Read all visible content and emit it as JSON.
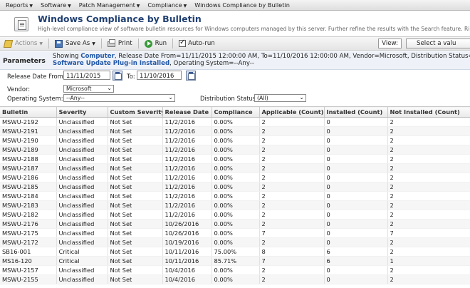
{
  "menu": [
    {
      "label": "Reports",
      "caret": true
    },
    {
      "label": "Software",
      "caret": true
    },
    {
      "label": "Patch Management",
      "caret": true
    },
    {
      "label": "Compliance",
      "caret": true
    },
    {
      "label": "Windows Compliance by Bulletin",
      "caret": false
    }
  ],
  "header": {
    "title": "Windows Compliance by Bulletin",
    "subtitle": "High-level compliance view of software bulletin resources for Windows computers managed by this server. Further refine the results with the Search feature. Ri"
  },
  "toolbar": {
    "actions_label": "Actions",
    "save_as_label": "Save As",
    "print_label": "Print",
    "run_label": "Run",
    "autorun_label": "Auto-run",
    "autorun_checked": true,
    "view_label": "View:",
    "view_select_value": "Select a valu"
  },
  "parameters": {
    "label": "Parameters",
    "line1_prefix": "Showing ",
    "line1_highlight": "Computer",
    "line1_rest": ", Release Date From=11/11/2015 12:00:00 AM, To=11/10/2016 12:00:00 AM, Vendor=Microsoft, Distribution Status=(",
    "line2_highlight": "Software Update Plug-in Installed",
    "line2_rest": ", Operating System=--Any--"
  },
  "filters": {
    "release_from_label": "Release Date From:",
    "release_from_value": "11/11/2015",
    "to_label": "To:",
    "to_value": "11/10/2016",
    "vendor_label": "Vendor:",
    "vendor_value": "Microsoft",
    "os_label": "Operating System:",
    "os_value": "--Any--",
    "dist_label": "Distribution Status:",
    "dist_value": "(All)"
  },
  "table": {
    "columns": [
      "Bulletin",
      "Severity",
      "Custom Severity",
      "Release Date",
      "Compliance",
      "Applicable (Count)",
      "Installed (Count)",
      "Not Installed (Count)"
    ],
    "rows": [
      [
        "MSWU-2192",
        "Unclassified",
        "Not Set",
        "11/2/2016",
        "0.00%",
        "2",
        "0",
        "2"
      ],
      [
        "MSWU-2191",
        "Unclassified",
        "Not Set",
        "11/2/2016",
        "0.00%",
        "2",
        "0",
        "2"
      ],
      [
        "MSWU-2190",
        "Unclassified",
        "Not Set",
        "11/2/2016",
        "0.00%",
        "2",
        "0",
        "2"
      ],
      [
        "MSWU-2189",
        "Unclassified",
        "Not Set",
        "11/2/2016",
        "0.00%",
        "2",
        "0",
        "2"
      ],
      [
        "MSWU-2188",
        "Unclassified",
        "Not Set",
        "11/2/2016",
        "0.00%",
        "2",
        "0",
        "2"
      ],
      [
        "MSWU-2187",
        "Unclassified",
        "Not Set",
        "11/2/2016",
        "0.00%",
        "2",
        "0",
        "2"
      ],
      [
        "MSWU-2186",
        "Unclassified",
        "Not Set",
        "11/2/2016",
        "0.00%",
        "2",
        "0",
        "2"
      ],
      [
        "MSWU-2185",
        "Unclassified",
        "Not Set",
        "11/2/2016",
        "0.00%",
        "2",
        "0",
        "2"
      ],
      [
        "MSWU-2184",
        "Unclassified",
        "Not Set",
        "11/2/2016",
        "0.00%",
        "2",
        "0",
        "2"
      ],
      [
        "MSWU-2183",
        "Unclassified",
        "Not Set",
        "11/2/2016",
        "0.00%",
        "2",
        "0",
        "2"
      ],
      [
        "MSWU-2182",
        "Unclassified",
        "Not Set",
        "11/2/2016",
        "0.00%",
        "2",
        "0",
        "2"
      ],
      [
        "MSWU-2176",
        "Unclassified",
        "Not Set",
        "10/26/2016",
        "0.00%",
        "2",
        "0",
        "2"
      ],
      [
        "MSWU-2175",
        "Unclassified",
        "Not Set",
        "10/26/2016",
        "0.00%",
        "7",
        "0",
        "7"
      ],
      [
        "MSWU-2172",
        "Unclassified",
        "Not Set",
        "10/19/2016",
        "0.00%",
        "2",
        "0",
        "2"
      ],
      [
        "SB16-001",
        "Critical",
        "Not Set",
        "10/11/2016",
        "75.00%",
        "8",
        "6",
        "2"
      ],
      [
        "MS16-120",
        "Critical",
        "Not Set",
        "10/11/2016",
        "85.71%",
        "7",
        "6",
        "1"
      ],
      [
        "MSWU-2157",
        "Unclassified",
        "Not Set",
        "10/4/2016",
        "0.00%",
        "2",
        "0",
        "2"
      ],
      [
        "MSWU-2155",
        "Unclassified",
        "Not Set",
        "10/4/2016",
        "0.00%",
        "2",
        "0",
        "2"
      ]
    ]
  }
}
